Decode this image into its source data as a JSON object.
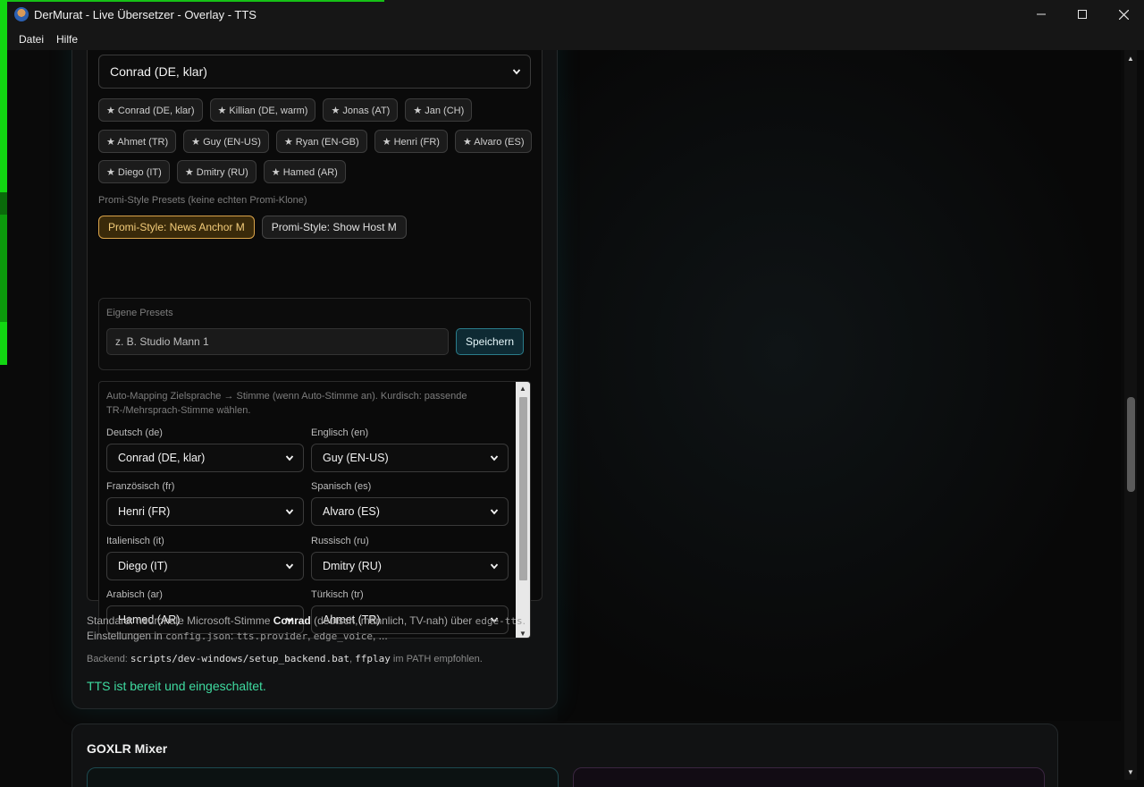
{
  "window": {
    "title": "DerMurat - Live Übersetzer - Overlay - TTS",
    "controls": {
      "minimize": "—",
      "maximize": "☐",
      "close": "✕"
    }
  },
  "menu": {
    "items": [
      "Datei",
      "Hilfe"
    ]
  },
  "tts": {
    "voice_select": "Conrad (DE, klar)",
    "voice_chips": [
      "★ Conrad (DE, klar)",
      "★ Killian (DE, warm)",
      "★ Jonas (AT)",
      "★ Jan (CH)",
      "★ Ahmet (TR)",
      "★ Guy (EN-US)",
      "★ Ryan (EN-GB)",
      "★ Henri (FR)",
      "★ Alvaro (ES)",
      "★ Diego (IT)",
      "★ Dmitry (RU)",
      "★ Hamed (AR)"
    ],
    "promi_label": "Promi-Style Presets (keine echten Promi-Klone)",
    "promi_presets": [
      "Promi-Style: News Anchor M",
      "Promi-Style: Show Host M"
    ],
    "own_presets": {
      "label": "Eigene Presets",
      "input_placeholder": "z. B. Studio Mann 1",
      "save_label": "Speichern"
    },
    "mapping": {
      "description": "Auto-Mapping Zielsprache → Stimme (wenn Auto-Stimme an). Kurdisch: passende TR-/Mehrsprach-Stimme wählen.",
      "rows": [
        {
          "label": "Deutsch (de)",
          "value": "Conrad (DE, klar)"
        },
        {
          "label": "Englisch (en)",
          "value": "Guy (EN-US)"
        },
        {
          "label": "Französisch (fr)",
          "value": "Henri (FR)"
        },
        {
          "label": "Spanisch (es)",
          "value": "Alvaro (ES)"
        },
        {
          "label": "Italienisch (it)",
          "value": "Diego (IT)"
        },
        {
          "label": "Russisch (ru)",
          "value": "Dmitry (RU)"
        },
        {
          "label": "Arabisch (ar)",
          "value": "Hamed (AR)"
        },
        {
          "label": "Türkisch (tr)",
          "value": "Ahmet (TR)"
        }
      ]
    },
    "footnote": {
      "standard_prefix": "Standard: neuronale Microsoft-Stimme ",
      "voice_name": "Conrad",
      "standard_mid": " (deutsch, männlich, TV-nah) über ",
      "engine": "edge-tts",
      "period": ".",
      "settings_prefix": "Einstellungen in ",
      "config_file": "config.json",
      "colon": ": ",
      "key1": "tts.provider",
      "comma": ", ",
      "key2": "edge_voice",
      "ellipsis": ", ...",
      "backend_prefix": "Backend: ",
      "backend_script": "scripts/dev-windows/setup_backend.bat",
      "backend_comma": ", ",
      "backend_tool": "ffplay",
      "backend_suffix": " im PATH empfohlen."
    },
    "status": "TTS ist bereit und eingeschaltet."
  },
  "goxlr": {
    "title": "GOXLR Mixer"
  },
  "colors": {
    "accent_green": "#3fdba0",
    "highlight_preset_bg": "#3a2a0a",
    "highlight_preset_border": "#d9a34a",
    "save_button_border": "#2a7c8a"
  }
}
